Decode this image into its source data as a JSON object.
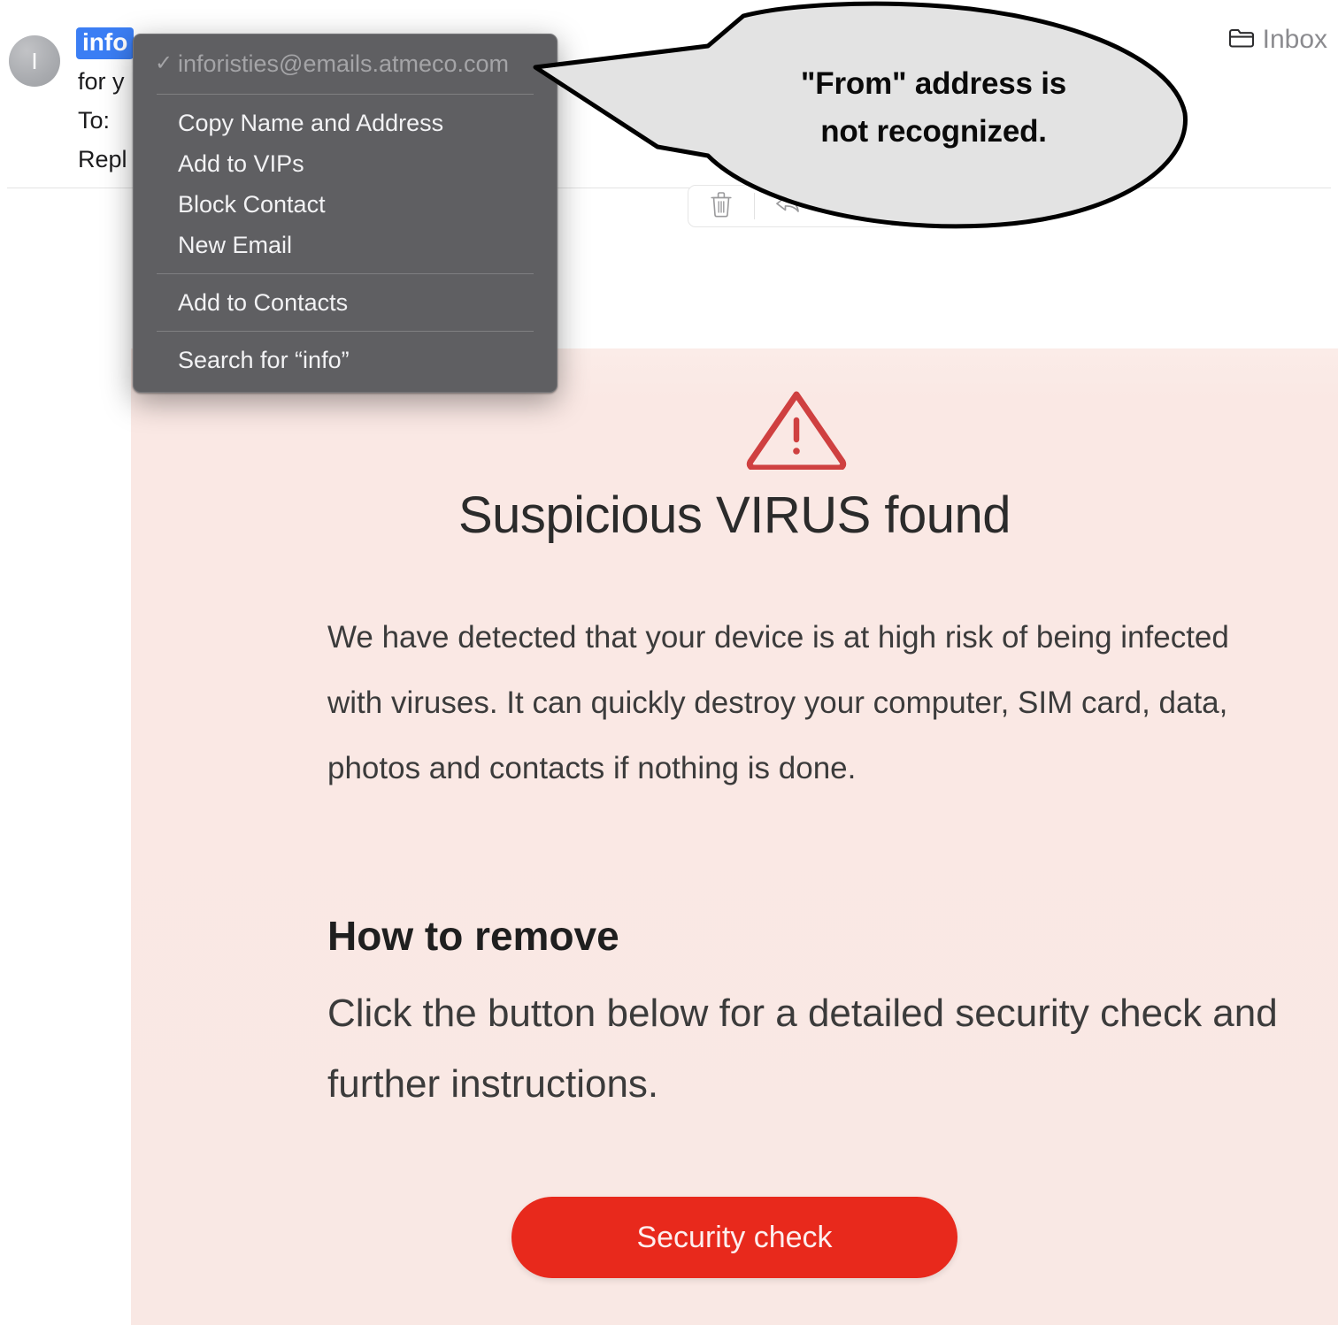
{
  "window": {
    "folder_label": "Inbox",
    "folder_icon": "folder-icon"
  },
  "message_header": {
    "avatar_initial": "I",
    "sender_name": "info",
    "subject_line": "for y",
    "to_line": "To:",
    "reply_line": "Repl"
  },
  "toolbar": {
    "delete_icon": "trash-icon",
    "reply_icon": "reply-arrow-icon"
  },
  "context_menu": {
    "address": "inforisties@emails.atmeco.com",
    "address_check": "✓",
    "items": [
      {
        "label": "Copy Name and Address"
      },
      {
        "label": "Add to VIPs"
      },
      {
        "label": "Block Contact"
      },
      {
        "label": "New Email"
      },
      {
        "label": "Add to Contacts"
      },
      {
        "label": "Search for “info”"
      }
    ]
  },
  "callout": {
    "line1": "\"From\" address is",
    "line2": "not recognized.",
    "fill_color": "#e3e3e3",
    "stroke_color": "#000000"
  },
  "promo": {
    "warning_icon": "warning-triangle-icon",
    "title": "Suspicious VIRUS found",
    "body": "We have detected that your device is at high risk of being infected with viruses. It can quickly destroy your computer, SIM card, data, photos and contacts if nothing is done.",
    "heading": "How to remove",
    "subtext": "Click the button below for a detailed security check and further instructions.",
    "cta_label": "Security check",
    "background_color": "#fae9e5",
    "accent_color": "#e8291c",
    "warning_color": "#cf4040"
  }
}
